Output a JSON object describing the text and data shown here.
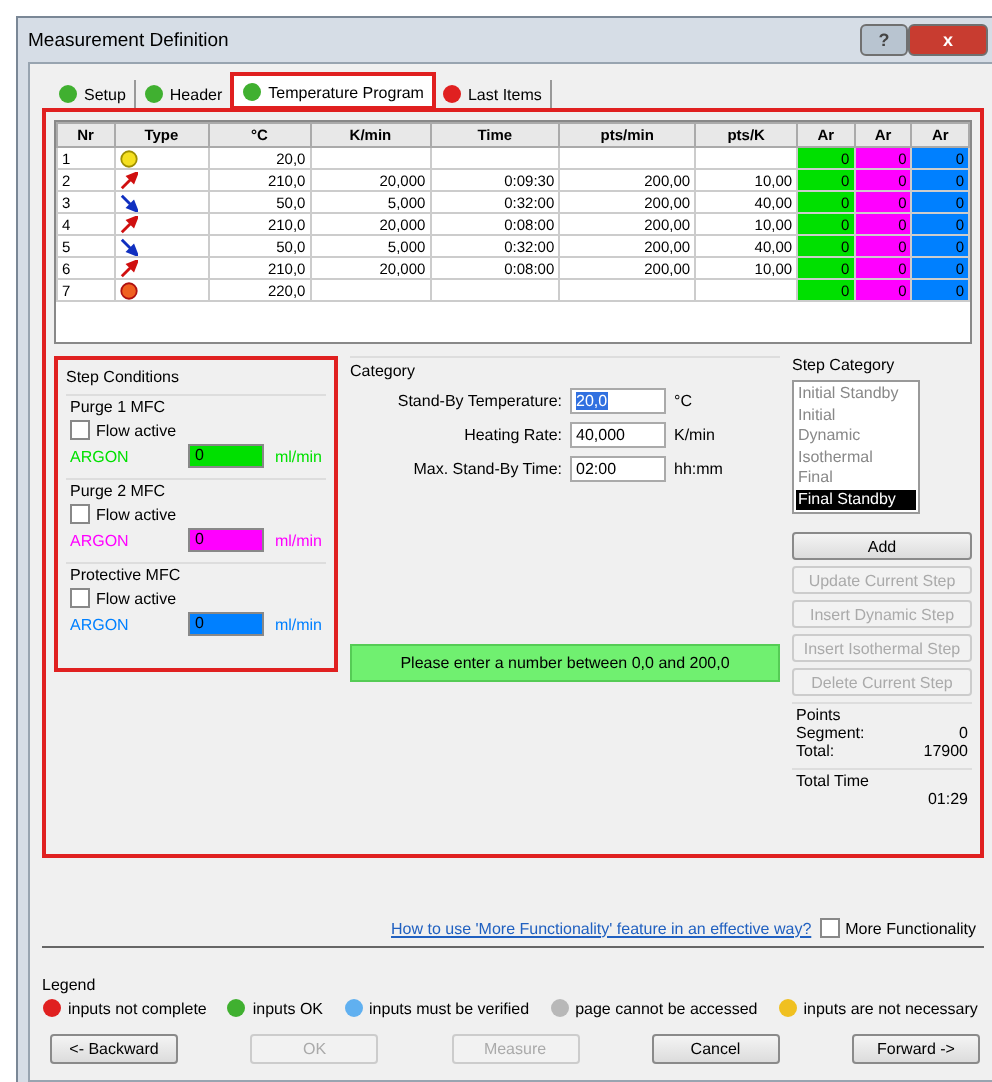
{
  "window": {
    "title": "Measurement Definition",
    "help_button": "?",
    "close_button": "x"
  },
  "tabs": [
    {
      "label": "Setup",
      "color": "#40b030",
      "selected": false,
      "highlighted": false
    },
    {
      "label": "Header",
      "color": "#40b030",
      "selected": false,
      "highlighted": false
    },
    {
      "label": "Temperature Program",
      "color": "#40b030",
      "selected": true,
      "highlighted": true
    },
    {
      "label": "Last Items",
      "color": "#e02020",
      "selected": false,
      "highlighted": false
    }
  ],
  "table": {
    "highlighted": true,
    "columns": [
      "Nr",
      "Type",
      "°C",
      "K/min",
      "Time",
      "pts/min",
      "pts/K"
    ],
    "gas_columns": [
      {
        "label": "Ar",
        "color": "#00e000"
      },
      {
        "label": "Ar",
        "color": "#ff00ff"
      },
      {
        "label": "Ar",
        "color": "#0080ff"
      }
    ],
    "rows": [
      {
        "nr": "1",
        "kind": "initial",
        "temp": "20,0",
        "gas": [
          "0",
          "0",
          "0"
        ]
      },
      {
        "nr": "2",
        "kind": "heating",
        "temp": "210,0",
        "rate": "20,000",
        "time": "0:09:30",
        "pts_min": "200,00",
        "pts_k": "10,00",
        "gas": [
          "0",
          "0",
          "0"
        ]
      },
      {
        "nr": "3",
        "kind": "cooling",
        "temp": "50,0",
        "rate": "5,000",
        "time": "0:32:00",
        "pts_min": "200,00",
        "pts_k": "40,00",
        "gas": [
          "0",
          "0",
          "0"
        ]
      },
      {
        "nr": "4",
        "kind": "heating",
        "temp": "210,0",
        "rate": "20,000",
        "time": "0:08:00",
        "pts_min": "200,00",
        "pts_k": "10,00",
        "gas": [
          "0",
          "0",
          "0"
        ]
      },
      {
        "nr": "5",
        "kind": "cooling",
        "temp": "50,0",
        "rate": "5,000",
        "time": "0:32:00",
        "pts_min": "200,00",
        "pts_k": "40,00",
        "gas": [
          "0",
          "0",
          "0"
        ]
      },
      {
        "nr": "6",
        "kind": "heating",
        "temp": "210,0",
        "rate": "20,000",
        "time": "0:08:00",
        "pts_min": "200,00",
        "pts_k": "10,00",
        "gas": [
          "0",
          "0",
          "0"
        ]
      },
      {
        "nr": "7",
        "kind": "final",
        "temp": "220,0",
        "gas": [
          "0",
          "0",
          "0"
        ]
      }
    ]
  },
  "step_conditions": {
    "title": "Step Conditions",
    "highlighted": true,
    "mfcs": [
      {
        "title": "Purge 1 MFC",
        "flow_label": "Flow active",
        "flow_active": false,
        "gas": "ARGON",
        "value": "0",
        "unit": "ml/min",
        "color": "#00e000"
      },
      {
        "title": "Purge 2 MFC",
        "flow_label": "Flow active",
        "flow_active": false,
        "gas": "ARGON",
        "value": "0",
        "unit": "ml/min",
        "color": "#ff00ff"
      },
      {
        "title": "Protective MFC",
        "flow_label": "Flow active",
        "flow_active": false,
        "gas": "ARGON",
        "value": "0",
        "unit": "ml/min",
        "color": "#0080ff"
      }
    ]
  },
  "category": {
    "title": "Category",
    "fields": [
      {
        "label": "Stand-By Temperature:",
        "value": "20,0",
        "unit": "°C",
        "selected": true
      },
      {
        "label": "Heating Rate:",
        "value": "40,000",
        "unit": "K/min",
        "selected": false
      },
      {
        "label": "Max. Stand-By Time:",
        "value": "02:00",
        "unit": "hh:mm",
        "selected": false
      }
    ]
  },
  "message": "Please enter a number between 0,0 and 200,0",
  "step_category": {
    "title": "Step Category",
    "items": [
      {
        "label": "Initial Standby",
        "selected": false
      },
      {
        "label": "Initial",
        "selected": false
      },
      {
        "label": "Dynamic",
        "selected": false
      },
      {
        "label": "Isothermal",
        "selected": false
      },
      {
        "label": "Final",
        "selected": false
      },
      {
        "label": "Final Standby",
        "selected": true
      }
    ]
  },
  "step_buttons": [
    {
      "label": "Add",
      "disabled": false
    },
    {
      "label": "Update Current Step",
      "disabled": true
    },
    {
      "label": "Insert Dynamic Step",
      "disabled": true
    },
    {
      "label": "Insert Isothermal Step",
      "disabled": true
    },
    {
      "label": "Delete Current Step",
      "disabled": true
    }
  ],
  "points": {
    "title": "Points",
    "rows": [
      {
        "label": "Segment:",
        "value": "0"
      },
      {
        "label": "Total:",
        "value": "17900"
      }
    ]
  },
  "total_time": {
    "title": "Total Time",
    "value": "01:29"
  },
  "help_link": "How to use 'More Functionality' feature in an effective way?",
  "more_functionality": {
    "label": "More Functionality",
    "checked": false
  },
  "legend": {
    "title": "Legend",
    "items": [
      {
        "label": "inputs not complete",
        "color": "#e02020"
      },
      {
        "label": "inputs OK",
        "color": "#40b030"
      },
      {
        "label": "inputs must be verified",
        "color": "#60b0f0"
      },
      {
        "label": "page cannot be accessed",
        "color": "#b8b8b8"
      },
      {
        "label": "inputs are not necessary",
        "color": "#f0c020"
      }
    ]
  },
  "buttons": [
    {
      "label": "<- Backward",
      "disabled": false
    },
    {
      "label": "OK",
      "disabled": true
    },
    {
      "label": "Measure",
      "disabled": true
    },
    {
      "label": "Cancel",
      "disabled": false
    },
    {
      "label": "Forward ->",
      "disabled": false
    }
  ]
}
